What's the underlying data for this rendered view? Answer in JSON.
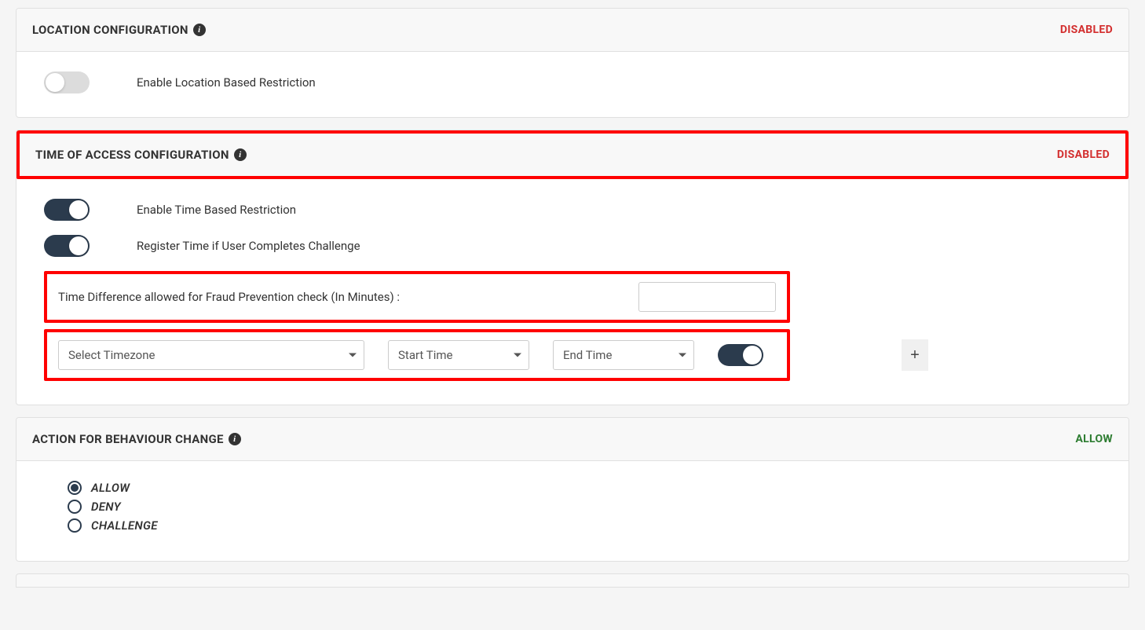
{
  "location": {
    "title": "LOCATION CONFIGURATION",
    "status": "DISABLED",
    "toggle_label": "Enable Location Based Restriction"
  },
  "time": {
    "title": "TIME OF ACCESS CONFIGURATION",
    "status": "DISABLED",
    "enable_label": "Enable Time Based Restriction",
    "register_label": "Register Time if User Completes Challenge",
    "fraud_label": "Time Difference allowed for Fraud Prevention check (In Minutes) :",
    "fraud_value": "",
    "timezone_placeholder": "Select Timezone",
    "start_placeholder": "Start Time",
    "end_placeholder": "End Time",
    "add_label": "+"
  },
  "action": {
    "title": "ACTION FOR BEHAVIOUR CHANGE",
    "status": "ALLOW",
    "options": {
      "allow": "ALLOW",
      "deny": "DENY",
      "challenge": "CHALLENGE"
    }
  }
}
